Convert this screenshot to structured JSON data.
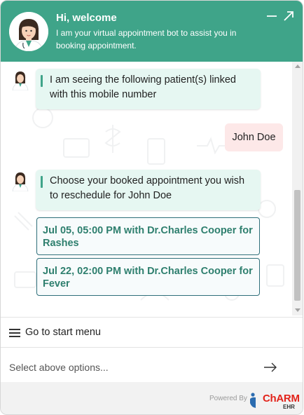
{
  "header": {
    "title": "Hi, welcome",
    "subtitle": "I am your virtual appointment bot to assist you in booking appointment.",
    "icons": [
      "minimize-icon",
      "expand-icon"
    ]
  },
  "chat": {
    "messages": [
      {
        "from": "bot",
        "text": "I am seeing the following patient(s) linked with this mobile number"
      },
      {
        "from": "user",
        "text": "John Doe"
      },
      {
        "from": "bot",
        "text": "Choose your booked appointment you wish to reschedule for John Doe"
      }
    ],
    "options": [
      {
        "label": "Jul 05, 05:00 PM with Dr.Charles Cooper for Rashes"
      },
      {
        "label": "Jul 22, 02:00 PM with Dr.Charles Cooper for Fever"
      }
    ]
  },
  "footer": {
    "start_menu_label": "Go to start menu",
    "input_placeholder": "Select above options...",
    "powered_by": "Powered By",
    "brand": "ChARM",
    "brand_sub": "EHR"
  },
  "colors": {
    "header_bg": "#3fa489",
    "bot_bubble": "#e6f7f2",
    "user_bubble": "#fde8e8",
    "option_text": "#2e7f6e",
    "brand_red": "#e2231a"
  }
}
